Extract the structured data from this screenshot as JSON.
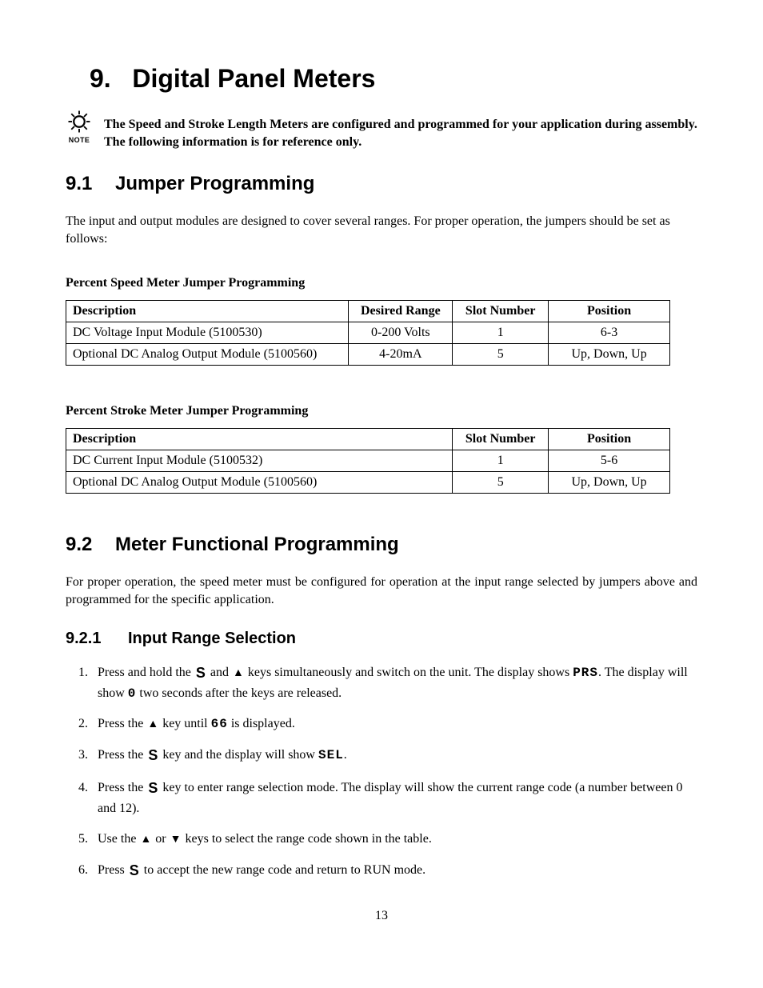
{
  "chapter": {
    "number": "9.",
    "title": "Digital Panel Meters"
  },
  "note": {
    "label": "NOTE",
    "text": "The Speed and Stroke Length Meters are configured and programmed for your application during assembly.  The following information is for reference only."
  },
  "s91": {
    "num": "9.1",
    "title": "Jumper Programming",
    "intro": "The input and output modules are designed to cover several ranges.  For proper operation, the jumpers should be set as follows:"
  },
  "table1": {
    "title": "Percent Speed Meter Jumper Programming",
    "headers": {
      "c1": "Description",
      "c2": "Desired Range",
      "c3": "Slot Number",
      "c4": "Position"
    },
    "rows": [
      {
        "c1": "DC Voltage Input Module (5100530)",
        "c2": "0-200 Volts",
        "c3": "1",
        "c4": "6-3"
      },
      {
        "c1": "Optional DC Analog Output Module (5100560)",
        "c2": "4-20mA",
        "c3": "5",
        "c4": "Up, Down, Up"
      }
    ]
  },
  "table2": {
    "title": "Percent Stroke Meter Jumper Programming",
    "headers": {
      "c1": "Description",
      "c2": "Slot Number",
      "c3": "Position"
    },
    "rows": [
      {
        "c1": "DC Current Input Module (5100532)",
        "c2": "1",
        "c3": "5-6"
      },
      {
        "c1": "Optional DC Analog Output Module (5100560)",
        "c2": "5",
        "c3": "Up, Down, Up"
      }
    ]
  },
  "s92": {
    "num": "9.2",
    "title": "Meter Functional Programming",
    "intro": "For proper operation, the speed meter must be configured for operation at the input range selected by jumpers above and programmed for the specific application."
  },
  "s921": {
    "num": "9.2.1",
    "title": "Input Range Selection"
  },
  "keys": {
    "S": "S",
    "up": "▲",
    "down": "▼"
  },
  "seg": {
    "PRS": "PRS",
    "zero": "0",
    "sixtysix": "66",
    "SEL": "SEL"
  },
  "steps": {
    "s1a": "Press and hold the ",
    "s1b": " and ",
    "s1c": " keys simultaneously and switch on the unit.  The display shows ",
    "s1d": ".  The display will show ",
    "s1e": " two seconds after the keys are released.",
    "s2a": "Press the ",
    "s2b": " key until ",
    "s2c": " is displayed.",
    "s3a": "Press the ",
    "s3b": " key and the display will show ",
    "s3c": ".",
    "s4a": "Press the ",
    "s4b": " key to enter range selection mode.  The display will show the current range code (a number between 0 and 12).",
    "s5a": "Use the ",
    "s5b": " or ",
    "s5c": " keys to select the range code shown in the table.",
    "s6a": "Press  ",
    "s6b": "  to accept the new range code and return to RUN mode."
  },
  "pageNumber": "13"
}
